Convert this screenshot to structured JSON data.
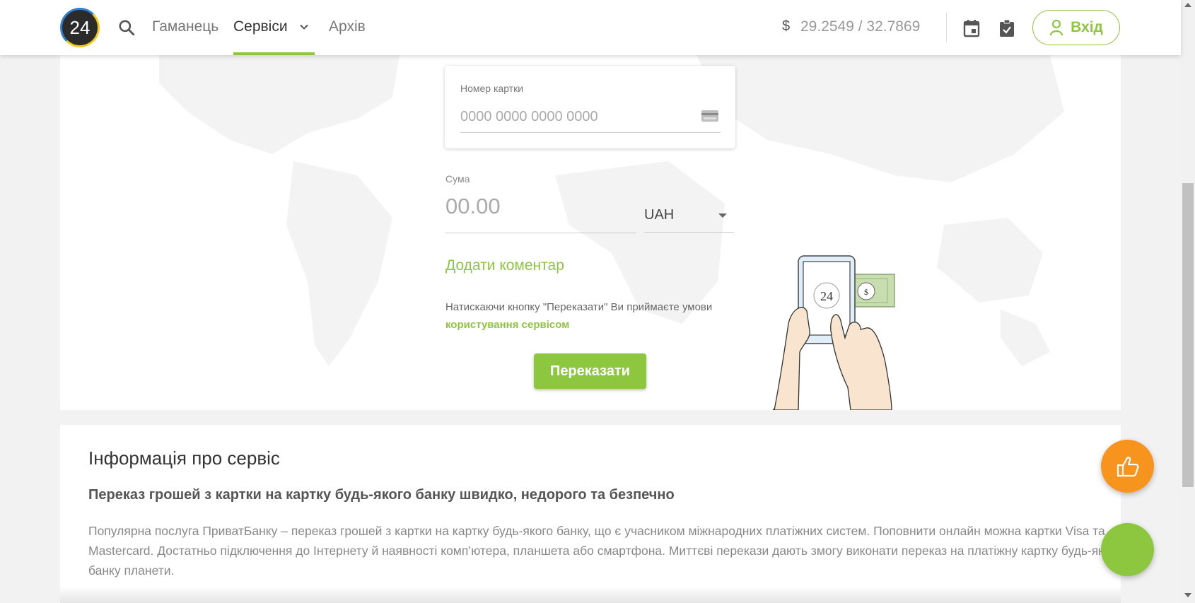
{
  "colors": {
    "accent": "#8dc63f",
    "orange": "#f7941d",
    "logo_dark": "#2b2b2b"
  },
  "header": {
    "logo_text": "24",
    "nav": {
      "wallet": "Гаманець",
      "services": "Сервіси",
      "archive": "Архів"
    },
    "rate": {
      "currency_sign": "$",
      "value": "29.2549 / 32.7869"
    },
    "login_label": "Вхід",
    "icons": [
      "search-icon",
      "chevron-down-icon",
      "calendar-icon",
      "clipboard-check-icon",
      "user-icon"
    ]
  },
  "form": {
    "card_number_label": "Номер картки",
    "card_number_placeholder": "0000 0000 0000 0000",
    "amount_label": "Сума",
    "amount_placeholder": "00.00",
    "currency": "UAH",
    "add_comment": "Додати коментар",
    "terms_text": "Натискаючи кнопку \"Переказати\" Ви приймаєте умови ",
    "terms_link": "користування сервісом",
    "submit_label": "Переказати"
  },
  "illustration": {
    "phone_badge": "24",
    "coin_sign": "$"
  },
  "info": {
    "title": "Інформація про сервіс",
    "subtitle": "Переказ грошей з картки на картку будь-якого банку швидко, недорого та безпечно",
    "text": "Популярна послуга ПриватБанку – переказ грошей з картки на картку будь-якого банку, що є учасником міжнародних платіжних систем. Поповнити онлайн можна картки Visa та Mastercard. Достатньо підключення до Інтернету й наявності комп’ютера, планшета або смартфона. Миттєві перекази дають змогу виконати переказ на платіжну картку будь-якого банку планети."
  }
}
